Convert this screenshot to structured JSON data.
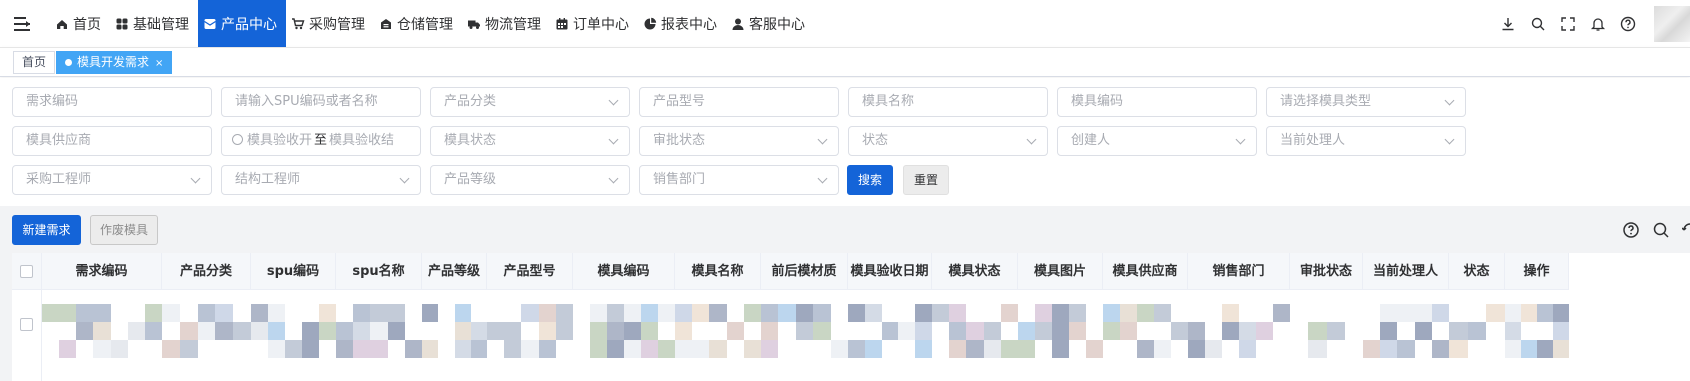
{
  "nav": {
    "items": [
      {
        "label": "首页",
        "icon": "home-icon"
      },
      {
        "label": "基础管理",
        "icon": "grid-icon"
      },
      {
        "label": "产品中心",
        "icon": "box-icon",
        "active": true
      },
      {
        "label": "采购管理",
        "icon": "cart-icon"
      },
      {
        "label": "仓储管理",
        "icon": "warehouse-icon"
      },
      {
        "label": "物流管理",
        "icon": "truck-icon"
      },
      {
        "label": "订单中心",
        "icon": "calendar-icon"
      },
      {
        "label": "报表中心",
        "icon": "pie-chart-icon"
      },
      {
        "label": "客服中心",
        "icon": "user-icon"
      }
    ]
  },
  "tags": {
    "home": "首页",
    "active": "模具开发需求",
    "close": "×"
  },
  "filters": {
    "row1": [
      {
        "placeholder": "需求编码",
        "type": "input"
      },
      {
        "placeholder": "请输入SPU编码或者名称",
        "type": "input"
      },
      {
        "placeholder": "产品分类",
        "type": "select"
      },
      {
        "placeholder": "产品型号",
        "type": "input"
      },
      {
        "placeholder": "模具名称",
        "type": "input"
      },
      {
        "placeholder": "模具编码",
        "type": "input"
      },
      {
        "placeholder": "请选择模具类型",
        "type": "select"
      }
    ],
    "row2": [
      {
        "placeholder": "模具供应商",
        "type": "input"
      },
      {
        "placeholder": "",
        "type": "date"
      },
      {
        "placeholder": "模具状态",
        "type": "select"
      },
      {
        "placeholder": "审批状态",
        "type": "select"
      },
      {
        "placeholder": "状态",
        "type": "select"
      },
      {
        "placeholder": "创建人",
        "type": "select"
      },
      {
        "placeholder": "当前处理人",
        "type": "select"
      }
    ],
    "row3": [
      {
        "placeholder": "采购工程师",
        "type": "select"
      },
      {
        "placeholder": "结构工程师",
        "type": "select"
      },
      {
        "placeholder": "产品等级",
        "type": "select"
      },
      {
        "placeholder": "销售部门",
        "type": "select"
      }
    ],
    "date_start": "模具验收开",
    "date_sep": "至",
    "date_end": "模具验收结",
    "search_label": "搜索",
    "reset_label": "重置"
  },
  "actions": {
    "new_label": "新建需求",
    "void_label": "作废模具"
  },
  "table": {
    "columns": [
      "需求编码",
      "产品分类",
      "spu编码",
      "spu名称",
      "产品等级",
      "产品型号",
      "模具编码",
      "模具名称",
      "前后模材质",
      "模具验收日期",
      "模具状态",
      "模具图片",
      "模具供应商",
      "销售部门",
      "审批状态",
      "当前处理人",
      "状态",
      "操作"
    ]
  },
  "colors": {
    "primary": "#1464d8",
    "tag_active": "#42a5f5"
  }
}
